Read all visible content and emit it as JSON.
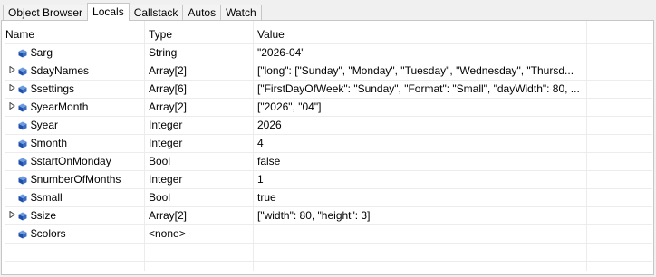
{
  "tabs": [
    "Object Browser",
    "Locals",
    "Callstack",
    "Autos",
    "Watch"
  ],
  "active_tab": "Locals",
  "columns": {
    "name": "Name",
    "type": "Type",
    "value": "Value"
  },
  "rows": [
    {
      "expandable": false,
      "name": "$arg",
      "type": "String",
      "value": "\"2026-04\""
    },
    {
      "expandable": true,
      "name": "$dayNames",
      "type": "Array[2]",
      "value": "[\"long\": [\"Sunday\", \"Monday\", \"Tuesday\", \"Wednesday\", \"Thursd..."
    },
    {
      "expandable": true,
      "name": "$settings",
      "type": "Array[6]",
      "value": "[\"FirstDayOfWeek\": \"Sunday\", \"Format\": \"Small\", \"dayWidth\": 80, ..."
    },
    {
      "expandable": true,
      "name": "$yearMonth",
      "type": "Array[2]",
      "value": "[\"2026\", \"04\"]"
    },
    {
      "expandable": false,
      "name": "$year",
      "type": "Integer",
      "value": "2026"
    },
    {
      "expandable": false,
      "name": "$month",
      "type": "Integer",
      "value": "4"
    },
    {
      "expandable": false,
      "name": "$startOnMonday",
      "type": "Bool",
      "value": "false"
    },
    {
      "expandable": false,
      "name": "$numberOfMonths",
      "type": "Integer",
      "value": "1"
    },
    {
      "expandable": false,
      "name": "$small",
      "type": "Bool",
      "value": "true"
    },
    {
      "expandable": true,
      "name": "$size",
      "type": "Array[2]",
      "value": "[\"width\": 80, \"height\": 3]"
    },
    {
      "expandable": false,
      "name": "$colors",
      "type": "<none>",
      "value": ""
    }
  ],
  "icons": {
    "variable": "variable-cube-icon",
    "expander": "expand-arrow-icon"
  },
  "colors": {
    "cube_dark": "#1f4fa8",
    "cube_light": "#6d9be0",
    "accent": "#1f4fa8"
  }
}
